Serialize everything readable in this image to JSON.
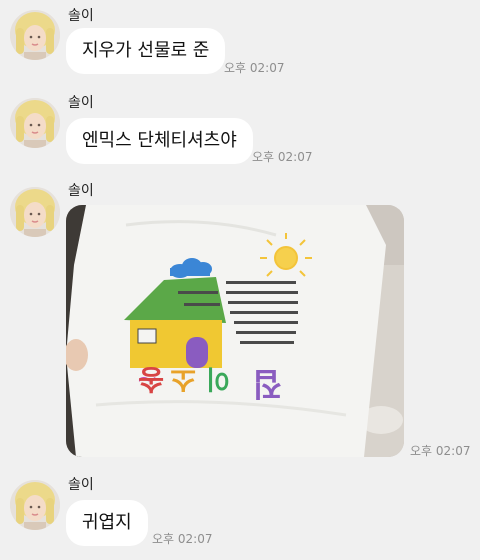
{
  "messages": [
    {
      "sender": "솔이",
      "text": "지우가 선물로 준",
      "time": "오후 02:07"
    },
    {
      "sender": "솔이",
      "text": "엔믹스 단체티셔츠야",
      "time": "오후 02:07"
    },
    {
      "sender": "솔이",
      "image": "tshirt-photo",
      "time": "오후 02:07"
    },
    {
      "sender": "솔이",
      "text": "귀엽지",
      "time": "오후 02:07"
    }
  ],
  "photo": {
    "shirt_text": "집이 소 송 ~",
    "colors": {
      "shirt": "#f4f4f2",
      "roof": "#5ba848",
      "house": "#f0c832",
      "door": "#8a5cc0",
      "sun": "#f3c43a",
      "cloud": "#3b86d6"
    }
  },
  "theme": {
    "background": "#f0f0f0",
    "bubble": "#ffffff",
    "time_color": "#8e8e8e"
  }
}
